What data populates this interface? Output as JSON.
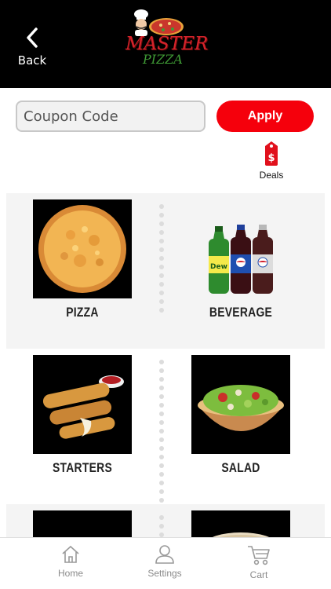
{
  "header": {
    "back_label": "Back",
    "logo_line1": "MASTER",
    "logo_line2": "PIZZA"
  },
  "coupon": {
    "placeholder": "Coupon Code",
    "apply_label": "Apply"
  },
  "deals": {
    "label": "Deals",
    "icon": "price-tag-icon"
  },
  "categories": [
    {
      "label": "PIZZA"
    },
    {
      "label": "BEVERAGE"
    },
    {
      "label": "STARTERS"
    },
    {
      "label": "SALAD"
    }
  ],
  "tabs": [
    {
      "label": "Home",
      "icon": "home-icon"
    },
    {
      "label": "Settings",
      "icon": "user-icon"
    },
    {
      "label": "Cart",
      "icon": "cart-icon"
    }
  ],
  "colors": {
    "header_bg": "#000000",
    "accent_red": "#f5000c",
    "row_shade": "#f4f4f4"
  }
}
